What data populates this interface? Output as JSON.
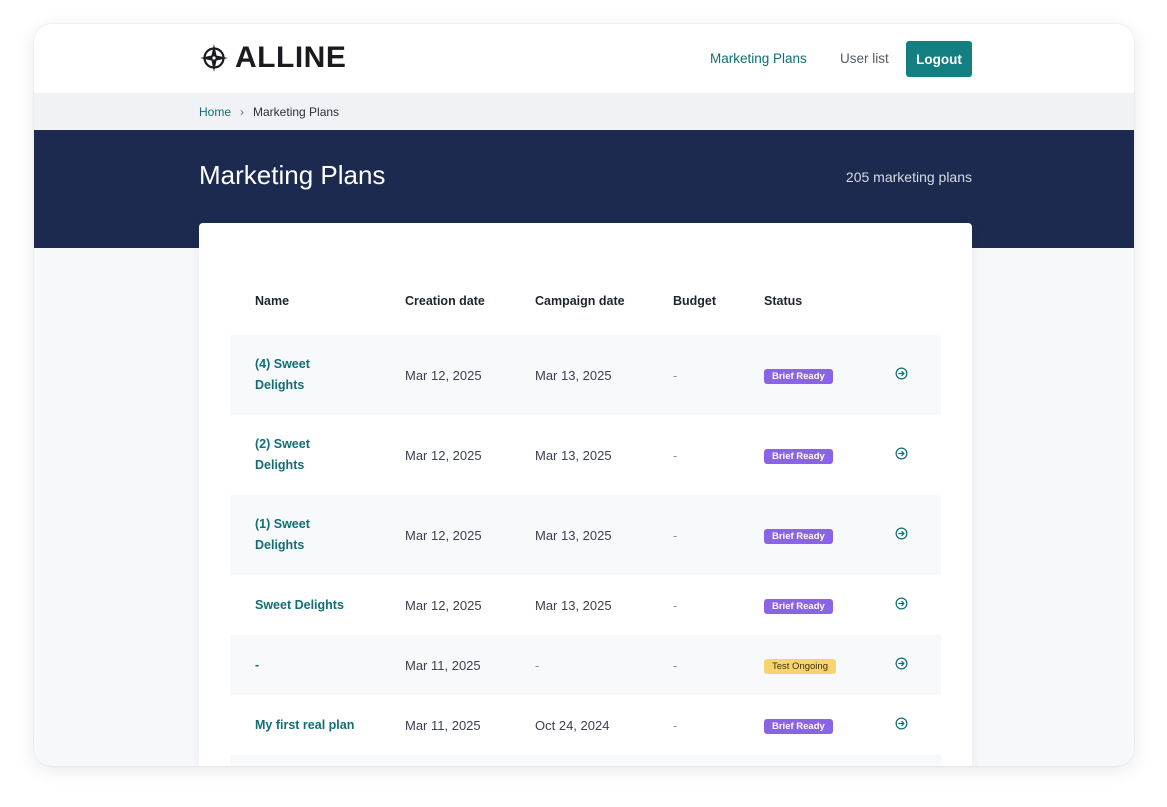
{
  "header": {
    "logo_text": "ALLINE",
    "nav": [
      {
        "label": "Marketing Plans",
        "active": true
      },
      {
        "label": "User list",
        "active": false
      }
    ],
    "logout_label": "Logout"
  },
  "breadcrumb": {
    "home": "Home",
    "separator": "›",
    "current": "Marketing Plans"
  },
  "hero": {
    "title": "Marketing Plans",
    "count": "205 marketing plans"
  },
  "table": {
    "columns": [
      "Name",
      "Creation date",
      "Campaign date",
      "Budget",
      "Status"
    ],
    "rows": [
      {
        "name": "(4) Sweet Delights",
        "created": "Mar 12, 2025",
        "campaign": "Mar 13, 2025",
        "budget": "-",
        "status": "Brief Ready"
      },
      {
        "name": "(2) Sweet Delights",
        "created": "Mar 12, 2025",
        "campaign": "Mar 13, 2025",
        "budget": "-",
        "status": "Brief Ready"
      },
      {
        "name": "(1) Sweet Delights",
        "created": "Mar 12, 2025",
        "campaign": "Mar 13, 2025",
        "budget": "-",
        "status": "Brief Ready"
      },
      {
        "name": "Sweet Delights",
        "created": "Mar 12, 2025",
        "campaign": "Mar 13, 2025",
        "budget": "-",
        "status": "Brief Ready"
      },
      {
        "name": "-",
        "created": "Mar 11, 2025",
        "campaign": "-",
        "budget": "-",
        "status": "Test Ongoing"
      },
      {
        "name": "My first real plan",
        "created": "Mar 11, 2025",
        "campaign": "Oct 24, 2024",
        "budget": "-",
        "status": "Brief Ready"
      }
    ]
  },
  "colors": {
    "brand_teal": "#147f80",
    "link_teal": "#0f6f74",
    "hero_navy": "#1d2a4f",
    "badge_brief": "#8a63e6",
    "badge_test": "#f7d470"
  },
  "icons": {
    "logo": "compass-star-icon",
    "row_action": "arrow-circle-right-icon"
  }
}
